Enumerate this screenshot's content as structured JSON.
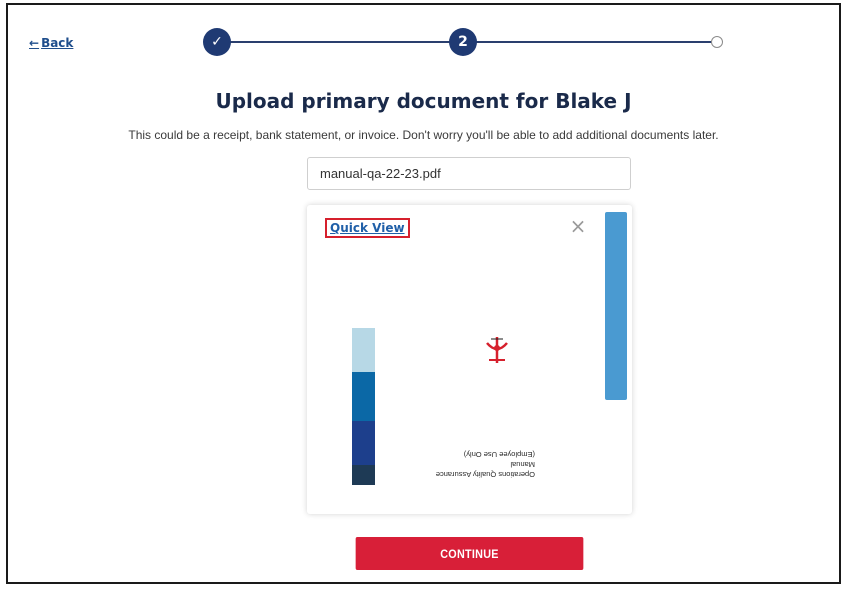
{
  "nav": {
    "back_label": "Back"
  },
  "stepper": {
    "step1_icon": "check-icon",
    "step2_label": "2"
  },
  "title": "Upload primary document for Blake J",
  "subtitle": "This could be a receipt, bank statement, or invoice. Don't worry you'll be able to add additional documents later.",
  "file": {
    "name": "manual-qa-22-23.pdf"
  },
  "preview": {
    "quick_view_label": "Quick View",
    "close_icon": "close-icon",
    "doc_lines": [
      "Operations Quality Assurance",
      "Manual",
      "(Employee Use Only)"
    ]
  },
  "actions": {
    "continue_label": "CONTINUE"
  },
  "colors": {
    "primary_navy": "#1f3a73",
    "continue_red": "#d81f38",
    "quick_view_highlight": "#d6202d",
    "scrollbar_blue": "#4a9ad1"
  }
}
